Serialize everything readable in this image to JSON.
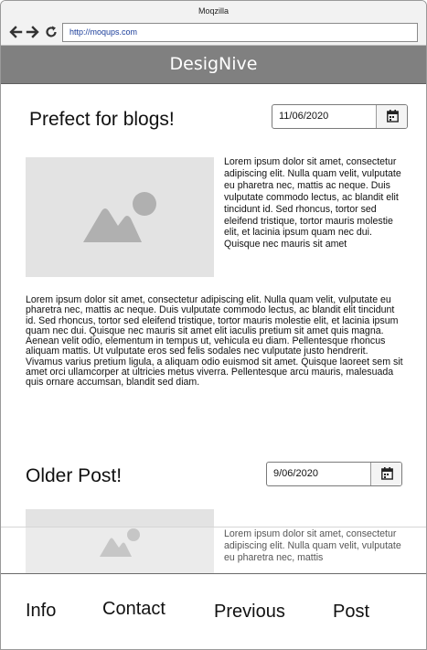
{
  "browser": {
    "window_title": "Moqzilla",
    "url": "http://moqups.com",
    "icons": [
      "back-arrow-icon",
      "forward-arrow-icon",
      "reload-icon"
    ]
  },
  "site": {
    "brand": "DesigNive",
    "header_color": "#808080"
  },
  "posts": [
    {
      "title": "Prefect for blogs!",
      "date": "11/06/2020",
      "image_icon": "image-placeholder-icon",
      "side_text": "Lorem ipsum dolor sit amet, consectetur adipiscing elit. Nulla quam velit, vulputate eu pharetra nec, mattis ac neque. Duis vulputate commodo lectus, ac blandit elit tincidunt id. Sed rhoncus, tortor sed eleifend tristique, tortor mauris molestie elit, et lacinia ipsum quam nec dui. Quisque nec mauris sit amet",
      "body_text": "Lorem ipsum dolor sit amet, consectetur adipiscing elit. Nulla quam velit, vulputate eu pharetra nec, mattis ac neque. Duis vulputate commodo lectus, ac blandit elit tincidunt id. Sed rhoncus, tortor sed eleifend tristique, tortor mauris molestie elit, et lacinia ipsum quam nec dui. Quisque nec mauris sit amet elit iaculis pretium sit amet quis magna. Aenean velit odio, elementum in tempus ut, vehicula eu diam. Pellentesque rhoncus aliquam mattis. Ut vulputate eros sed felis sodales nec vulputate justo hendrerit. Vivamus varius pretium ligula, a aliquam odio euismod sit amet. Quisque laoreet sem sit amet orci ullamcorper at ultricies metus viverra. Pellentesque arcu mauris, malesuada quis ornare accumsan, blandit sed diam."
    },
    {
      "title": "Older Post!",
      "date": "9/06/2020",
      "image_icon": "image-placeholder-icon",
      "side_text": "Lorem ipsum dolor sit amet, consectetur adipiscing elit. Nulla quam velit, vulputate eu pharetra nec, mattis"
    }
  ],
  "bottom_nav": [
    "Info",
    "Contact",
    "Previous",
    "Post"
  ]
}
